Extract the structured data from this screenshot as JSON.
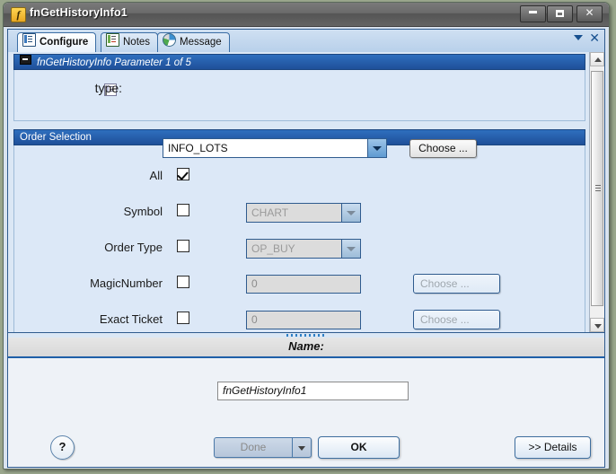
{
  "window": {
    "title": "fnGetHistoryInfo1",
    "icon": "function-f-icon",
    "minimize_label": "",
    "maximize_label": "",
    "close_label": "✕"
  },
  "tabs": [
    {
      "label": "Configure",
      "icon": "configure-list-icon",
      "active": true
    },
    {
      "label": "Notes",
      "icon": "notes-icon",
      "active": false
    },
    {
      "label": "Message",
      "icon": "message-globe-icon",
      "active": false
    }
  ],
  "tab_controls": {
    "menu_arrow": "chevron-down-icon",
    "close": "✕"
  },
  "parameter_group": {
    "header": "fnGetHistoryInfo Parameter 1 of 5",
    "collapse_icon": "collapse-minus-icon",
    "type_label": "type:",
    "type_icon": "enum-list-icon",
    "type_value": "INFO_LOTS",
    "choose_button": "Choose ..."
  },
  "order_selection": {
    "header": "Order Selection",
    "rows": [
      {
        "label": "All",
        "checked": true,
        "value": null,
        "choose": null,
        "disabled": false
      },
      {
        "label": "Symbol",
        "checked": false,
        "value": "CHART",
        "control": "combo",
        "disabled": true
      },
      {
        "label": "Order Type",
        "checked": false,
        "value": "OP_BUY",
        "control": "combo",
        "disabled": true
      },
      {
        "label": "MagicNumber",
        "checked": false,
        "value": "0",
        "control": "text",
        "choose": "Choose ...",
        "disabled": true
      },
      {
        "label": "Exact Ticket",
        "checked": false,
        "value": "0",
        "control": "text",
        "choose": "Choose ...",
        "disabled": true
      }
    ]
  },
  "name_panel": {
    "header": "Name:",
    "value": "fnGetHistoryInfo1"
  },
  "footer": {
    "help": "?",
    "done": "Done",
    "done_disabled": true,
    "ok": "OK",
    "details": ">> Details"
  },
  "colors": {
    "accent": "#1f5fa8",
    "group_header_start": "#2f6fbe",
    "group_header_end": "#1f4f99",
    "panel_bg": "#dce8f7",
    "titlebar": "#6a6a6a",
    "desktop": "#9aa68c"
  }
}
